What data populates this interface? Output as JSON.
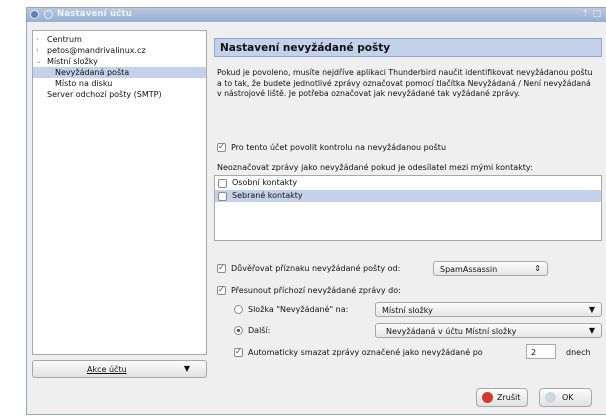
{
  "window": {
    "title": "Nastavení účtu"
  },
  "sidebar": {
    "items": [
      {
        "label": "Centrum"
      },
      {
        "label": "petos@mandrivalinux.cz"
      },
      {
        "label": "Místní složky"
      },
      {
        "label": "Nevyžádaná pošta"
      },
      {
        "label": "Místo na disku"
      },
      {
        "label": "Server odchozí pošty (SMTP)"
      }
    ],
    "account_actions": "Akce účtu"
  },
  "panel": {
    "title": "Nastavení nevyžádané pošty",
    "description": "Pokud je povoleno, musíte nejdříve aplikaci Thunderbird naučit identifikovat nevyžádanou poštu a to tak, že budete jednotlivé zprávy označovat pomocí tlačítka Nevyžádaná / Není nevyžádaná v nástrojové liště. Je potřeba označovat jak nevyžádané tak vyžádané zprávy.",
    "enable_label": "Pro tento účet povolit kontrolu na nevyžádanou poštu",
    "whitelist_label": "Neoznačovat zprávy jako nevyžádané pokud je odesílatel mezi mými kontakty:",
    "contacts": [
      {
        "label": "Osobní kontakty",
        "checked": false
      },
      {
        "label": "Sebrané kontakty",
        "checked": false
      }
    ],
    "trust_label": "Důvěřovat příznaku nevyžádané pošty od:",
    "trust_value": "SpamAssassin",
    "move_label": "Přesunout příchozí nevyžádané zprávy do:",
    "folder_option_label": "Složka \"Nevyžádané\" na:",
    "folder_option_value": "Místní složky",
    "other_option_label": "Další:",
    "other_option_value": "Nevyžádaná v účtu Místní složky",
    "auto_delete_label": "Automaticky smazat zprávy označené jako nevyžádané po",
    "auto_delete_days": "2",
    "auto_delete_unit": "dnech"
  },
  "buttons": {
    "cancel": "Zrušit",
    "ok": "OK"
  },
  "colors": {
    "selection": "#c3d2ea",
    "titlebar": "#98add0"
  }
}
